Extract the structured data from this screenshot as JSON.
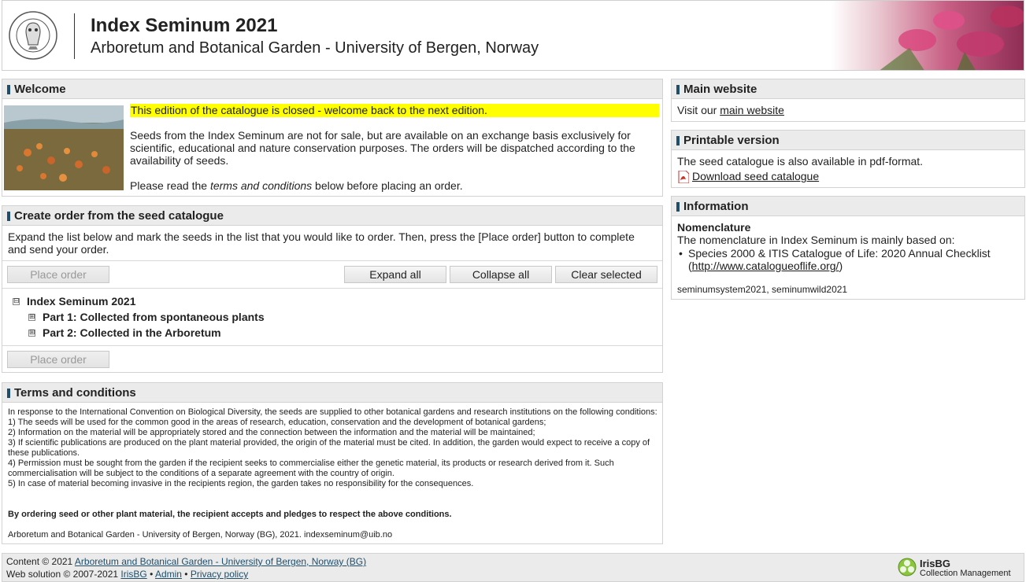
{
  "header": {
    "title": "Index Seminum 2021",
    "subtitle": "Arboretum and Botanical Garden - University of Bergen, Norway",
    "logo_text": "UNIVERSITAS BERGENSIS"
  },
  "welcome": {
    "heading": "Welcome",
    "closed_notice": "This edition of the catalogue is closed - welcome back to the next edition.",
    "description": "Seeds from the Index Seminum are not for sale, but are available on an exchange basis exclusively for scientific, educational and nature conservation purposes. The orders will be dispatched according to the availability of seeds.",
    "read_prefix": "Please read the ",
    "read_emph": "terms and conditions",
    "read_suffix": " below before placing an order."
  },
  "order": {
    "heading": "Create order from the seed catalogue",
    "intro": "Expand the list below and mark the seeds in the list that you would like to order. Then, press the [Place order] button to complete and send your order.",
    "place_order": "Place order",
    "expand_all": "Expand all",
    "collapse_all": "Collapse all",
    "clear_selected": "Clear selected",
    "tree": {
      "root": "Index Seminum 2021",
      "root_toggle": "⊟",
      "part1": "Part 1: Collected from spontaneous plants",
      "part2": "Part 2: Collected in the Arboretum",
      "child_toggle": "⊞"
    }
  },
  "terms": {
    "heading": "Terms and conditions",
    "intro": "In response to the International Convention on Biological Diversity, the seeds are supplied to other botanical gardens and research institutions on the following conditions:",
    "items": [
      "1) The seeds will be used for the common good in the areas of research, education, conservation and the development of botanical gardens;",
      "2) Information on the material will be appropriately stored and the connection between the information and the material will be maintained;",
      "3) If scientific publications are produced on the plant material provided, the origin of the material must be cited. In addition, the garden would expect to receive a copy of these publications.",
      "4) Permission must be sought from the garden if the recipient seeks to commercialise either the genetic material, its products or research derived from it. Such commercialisation will be subject to the conditions of a separate agreement with the country of origin.",
      "5) In case of material becoming invasive in the recipients region, the garden takes no responsibility for the consequences."
    ],
    "bold_statement": "By ordering seed or other plant material, the recipient accepts and pledges to respect the above conditions.",
    "footer_line": "Arboretum and Botanical Garden - University of Bergen, Norway (BG), 2021. indexseminum@uib.no"
  },
  "main_website": {
    "heading": "Main website",
    "prefix": "Visit our ",
    "link": "main website"
  },
  "printable": {
    "heading": "Printable version",
    "text": "The seed catalogue is also available in pdf-format.",
    "link": "Download seed catalogue"
  },
  "information": {
    "heading": "Information",
    "subheading": "Nomenclature",
    "text": "The nomenclature in Index Seminum is mainly based on:",
    "bullet": "•",
    "item_text": "Species 2000 & ITIS Catalogue of Life: 2020 Annual Checklist (",
    "item_link": "http://www.catalogueoflife.org/",
    "item_close": ")",
    "systems": "seminumsystem2021, seminumwild2021"
  },
  "footer": {
    "content_prefix": "Content © 2021 ",
    "content_link": "Arboretum and Botanical Garden - University of Bergen, Norway (BG)",
    "web_prefix": "Web solution © 2007-2021 ",
    "irisbg_link": "IrisBG",
    "sep": " • ",
    "admin_link": "Admin",
    "privacy_link": "Privacy policy",
    "brand_name": "IrisBG",
    "brand_sub": "Collection Management"
  },
  "colors": {
    "highlight": "#ffff00",
    "panel_head": "#ebebeb",
    "accent": "#1f4e6b"
  }
}
